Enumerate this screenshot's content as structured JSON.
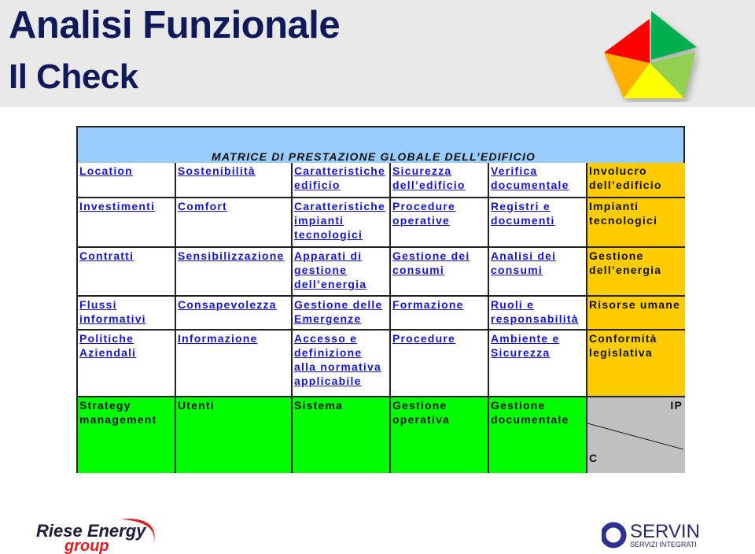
{
  "header": {
    "title": "Analisi Funzionale",
    "subtitle": "Il Check"
  },
  "matrix": {
    "title": "MATRICE DI PRESTAZIONE GLOBALE DELL’EDIFICIO",
    "rows": [
      [
        "Location",
        "Sostenibilità",
        "Caratteristiche edificio",
        "Sicurezza dell’edificio",
        "Verifica documentale",
        "Involucro dell’edificio"
      ],
      [
        "Investimenti",
        "Comfort",
        "Caratteristiche impianti tecnologici",
        "Procedure operative",
        "Registri e documenti",
        "Impianti tecnologici"
      ],
      [
        "Contratti",
        "Sensibilizzazione",
        "Apparati di gestione dell’energia",
        "Gestione dei consumi",
        "Analisi dei consumi",
        "Gestione dell’energia"
      ],
      [
        "Flussi informativi",
        "Consapevolezza",
        "Gestione delle Emergenze",
        "Formazione",
        "Ruoli e responsabilità",
        "Risorse umane"
      ],
      [
        "Politiche Aziendali",
        "Informazione",
        "Accesso e definizione alla normativa applicabile",
        "Procedure",
        "Ambiente e Sicurezza",
        "Conformità legislativa"
      ],
      [
        "Strategy management",
        "Utenti",
        "Sistema",
        "Gestione operativa",
        "Gestione documentale",
        ""
      ]
    ],
    "corner_top_label": "IP",
    "corner_bottom_label": "C"
  },
  "colors": {
    "title": "#10195a",
    "header_band": "#e9e9e9",
    "matrix_title_bg": "#99ccff",
    "link": "#1414d2",
    "category_column": "#ffcc00",
    "bottom_row": "#00ff00",
    "corner_cell": "#c0c0c0"
  },
  "footer": {
    "left_logo_line1": "Riese Energy",
    "left_logo_line2": "group",
    "right_logo_line1": "SERVIN",
    "right_logo_line2": "SERVIZI INTEGRATI"
  }
}
